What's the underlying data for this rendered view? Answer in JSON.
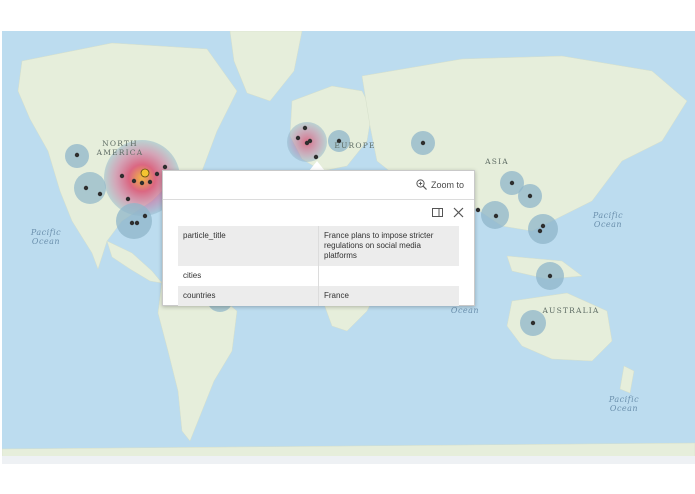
{
  "map": {
    "labels": {
      "north_america": "NORTH\nAMERICA",
      "europe": "EUROPE",
      "asia": "ASIA",
      "australia": "AUSTRALIA",
      "pacific_west": "Pacific\nOcean",
      "pacific_east": "Pacific\nOcean",
      "pacific_south": "Pacific\nOcean",
      "indian": "Ocean"
    },
    "colors": {
      "ocean": "#bcdcef",
      "land": "#e9efe0",
      "cluster": "#8fb6c9",
      "hotspot": "#d94f72",
      "point": "#2e2e2e",
      "selected_point": "#f4c430"
    }
  },
  "popup": {
    "zoom_to_label": "Zoom to",
    "zoom_icon": "zoom-in-icon",
    "dock_icon": "dock-icon",
    "close_icon": "close-icon",
    "rows": [
      {
        "key": "particle_title",
        "value": "France plans to impose stricter regulations on social media platforms"
      },
      {
        "key": "cities",
        "value": ""
      },
      {
        "key": "countries",
        "value": "France"
      }
    ]
  }
}
